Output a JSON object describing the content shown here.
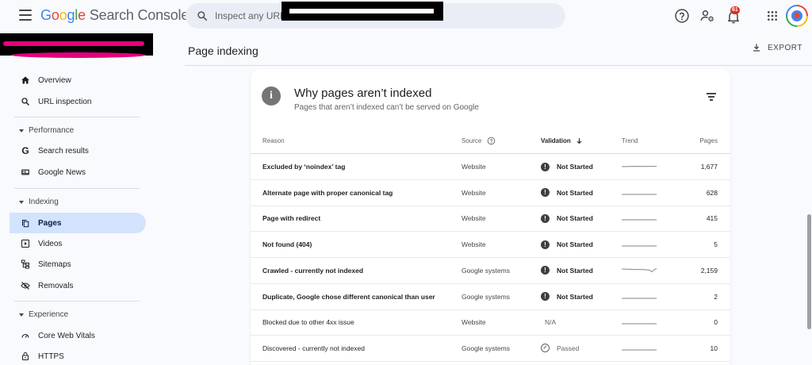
{
  "app": {
    "logo_parts": [
      "G",
      "o",
      "o",
      "g",
      "l",
      "e"
    ],
    "logo_rest": "Search Console"
  },
  "search": {
    "placeholder": "Inspect any URL i"
  },
  "notifications": {
    "badge_count": "61"
  },
  "header": {
    "title": "Page indexing",
    "export_label": "EXPORT"
  },
  "sidebar": {
    "items": [
      {
        "label": "Overview",
        "icon": "home-icon"
      },
      {
        "label": "URL inspection",
        "icon": "search-icon"
      },
      {
        "label": "Performance",
        "type": "section"
      },
      {
        "label": "Search results",
        "icon": "google-g-icon"
      },
      {
        "label": "Google News",
        "icon": "news-icon"
      },
      {
        "label": "Indexing",
        "type": "section"
      },
      {
        "label": "Pages",
        "icon": "pages-icon",
        "active": true
      },
      {
        "label": "Videos",
        "icon": "video-icon"
      },
      {
        "label": "Sitemaps",
        "icon": "sitemap-icon"
      },
      {
        "label": "Removals",
        "icon": "eye-off-icon"
      },
      {
        "label": "Experience",
        "type": "section"
      },
      {
        "label": "Core Web Vitals",
        "icon": "gauge-icon"
      },
      {
        "label": "HTTPS",
        "icon": "lock-icon"
      }
    ]
  },
  "card": {
    "title": "Why pages aren’t indexed",
    "subtitle": "Pages that aren’t indexed can’t be served on Google",
    "columns": {
      "reason": "Reason",
      "source": "Source",
      "validation": "Validation",
      "trend": "Trend",
      "pages": "Pages"
    },
    "rows": [
      {
        "reason": "Excluded by ‘noindex’ tag",
        "source": "Website",
        "validation": "Not Started",
        "status": "not-started",
        "pages": "1,677",
        "trend_shape": "flat-high"
      },
      {
        "reason": "Alternate page with proper canonical tag",
        "source": "Website",
        "validation": "Not Started",
        "status": "not-started",
        "pages": "628",
        "trend_shape": "flat"
      },
      {
        "reason": "Page with redirect",
        "source": "Website",
        "validation": "Not Started",
        "status": "not-started",
        "pages": "415",
        "trend_shape": "flat"
      },
      {
        "reason": "Not found (404)",
        "source": "Website",
        "validation": "Not Started",
        "status": "not-started",
        "pages": "5",
        "trend_shape": "flat"
      },
      {
        "reason": "Crawled - currently not indexed",
        "source": "Google systems",
        "validation": "Not Started",
        "status": "not-started",
        "pages": "2,159",
        "trend_shape": "dip"
      },
      {
        "reason": "Duplicate, Google chose different canonical than user",
        "source": "Google systems",
        "validation": "Not Started",
        "status": "not-started",
        "pages": "2",
        "trend_shape": "flat"
      },
      {
        "reason": "Blocked due to other 4xx issue",
        "source": "Website",
        "validation": "N/A",
        "status": "na",
        "pages": "0",
        "trend_shape": "flat"
      },
      {
        "reason": "Discovered - currently not indexed",
        "source": "Google systems",
        "validation": "Passed",
        "status": "passed",
        "pages": "10",
        "trend_shape": "flat"
      }
    ]
  }
}
